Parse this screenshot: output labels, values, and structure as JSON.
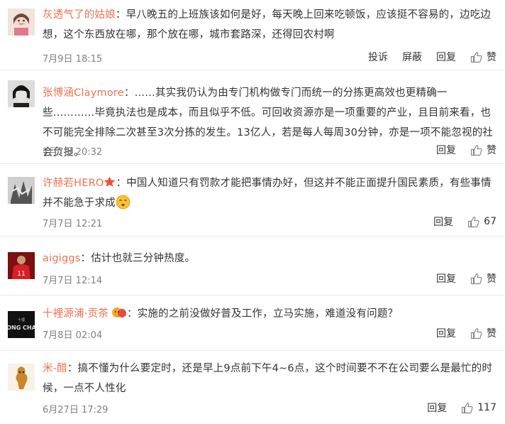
{
  "comments": [
    {
      "user": "灰透气了的姑娘",
      "text": "早八晚五的上班族该如何是好，每天晚上回来吃顿饭，应该挺不容易的，边吃边想，这个东西放在哪，那个放在哪，城市套路深，还得回农村啊",
      "time": "7月9日 18:15",
      "report": "投诉",
      "block": "屏蔽",
      "reply": "回复",
      "like": "赞"
    },
    {
      "user": "张博涵Claymore",
      "text": "……其实我仍认为由专门机构做专门而统一的分拣更高效也更精确一些…………毕竟执法也是成本，而且似乎不低。可回收资源亦是一项重要的产业，且目前来看，也不可能完全排除二次甚至3次分拣的发生。13亿人，若是每人每周30分钟，亦是一项不能忽视的社会负担。",
      "time": "7月7日 20:32",
      "reply": "回复",
      "like": "赞"
    },
    {
      "user": "许赫若HERO",
      "text": "中国人知道只有罚款才能把事情办好，但这并不能正面提升国民素质，有些事情并不能急于求成",
      "time": "7月7日 12:21",
      "reply": "回复",
      "like": "67"
    },
    {
      "user": "aigiggs",
      "text": "估计也就三分钟热度。",
      "time": "7月7日 12:14",
      "reply": "回复",
      "like": "赞"
    },
    {
      "user": "十裡源浦·贡茶",
      "text": "实施的之前没做好普及工作，立马实施，难道没有问题？",
      "time": "7月8日 02:04",
      "reply": "回复",
      "like": "赞"
    },
    {
      "user": "米-醋",
      "text": "搞不懂为什么要定时，还是早上9点前下午4~6点，这个时间要不不在公司要么是最忙的时候，一点不人性化",
      "time": "6月27日 17:29",
      "reply": "回复",
      "like": "117"
    }
  ],
  "colors": {
    "username": "#eb7350",
    "text": "#333333",
    "time": "#808080",
    "separator": "#e8e8e8"
  },
  "icons": [
    "thumbs-up-icon",
    "star-icon",
    "emoji-icon",
    "vip-badge-icon"
  ]
}
